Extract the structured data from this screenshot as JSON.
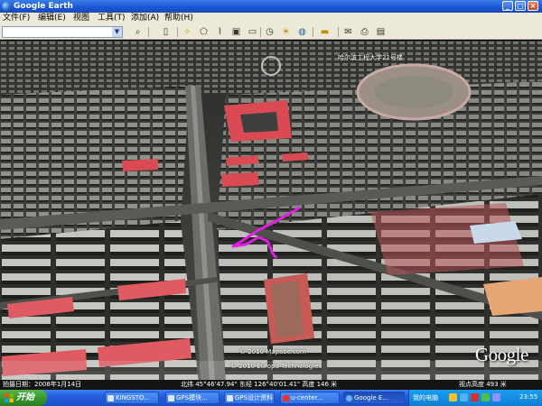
{
  "window": {
    "title": "Google Earth",
    "controls": {
      "minimize": "_",
      "maximize": "□",
      "close": "×"
    }
  },
  "menubar": {
    "items": [
      {
        "label": "文件(F)"
      },
      {
        "label": "编辑(E)"
      },
      {
        "label": "视图"
      },
      {
        "label": "工具(T)"
      },
      {
        "label": "添加(A)"
      },
      {
        "label": "帮助(H)"
      }
    ]
  },
  "toolbar": {
    "search_value": "",
    "buttons": [
      {
        "icon": "search-icon",
        "glyph": "⌕"
      },
      {
        "icon": "sidebar-icon",
        "glyph": "▯"
      },
      {
        "icon": "placemark-icon",
        "glyph": "✧"
      },
      {
        "icon": "polygon-icon",
        "glyph": "⬠"
      },
      {
        "icon": "path-icon",
        "glyph": "⌇"
      },
      {
        "icon": "image-overlay-icon",
        "glyph": "▣"
      },
      {
        "icon": "record-tour-icon",
        "glyph": "▭"
      },
      {
        "icon": "historical-imagery-icon",
        "glyph": "◷"
      },
      {
        "icon": "sunlight-icon",
        "glyph": "☀"
      },
      {
        "icon": "switch-to-sky-icon",
        "glyph": "◍"
      },
      {
        "icon": "ruler-icon",
        "glyph": "▬"
      },
      {
        "icon": "email-icon",
        "glyph": "✉"
      },
      {
        "icon": "print-icon",
        "glyph": "⎙"
      },
      {
        "icon": "view-in-google-maps-icon",
        "glyph": "▤"
      }
    ]
  },
  "map": {
    "labels": [
      {
        "text": "哈尔滨工程大学21号楼"
      }
    ],
    "copyright": [
      "© 2010 Mapabc.com",
      "© 2010 Europa Technologies"
    ],
    "logo": "Google"
  },
  "statusbar": {
    "date": "拍摄日期：2008年1月14日",
    "coordinates": "北纬 45°46'47.94\"  东经 126°40'01.41\"  高度 146 米",
    "view_altitude": "视点高度 493 米"
  },
  "taskbar": {
    "start_label": "开始",
    "tasks": [
      {
        "label": "KINGSTO..."
      },
      {
        "label": "GPS模块..."
      },
      {
        "label": "GPS设计资料"
      },
      {
        "label": "u-center..."
      },
      {
        "label": "Google E..."
      }
    ],
    "tray": {
      "my_computer": "我的电脑",
      "time": "23:55"
    }
  },
  "colors": {
    "titlebar": "#1c55d4",
    "path": "#e020e0",
    "roofs_red": "#d94a52",
    "taskbar": "#245ddb",
    "start": "#34922b"
  }
}
